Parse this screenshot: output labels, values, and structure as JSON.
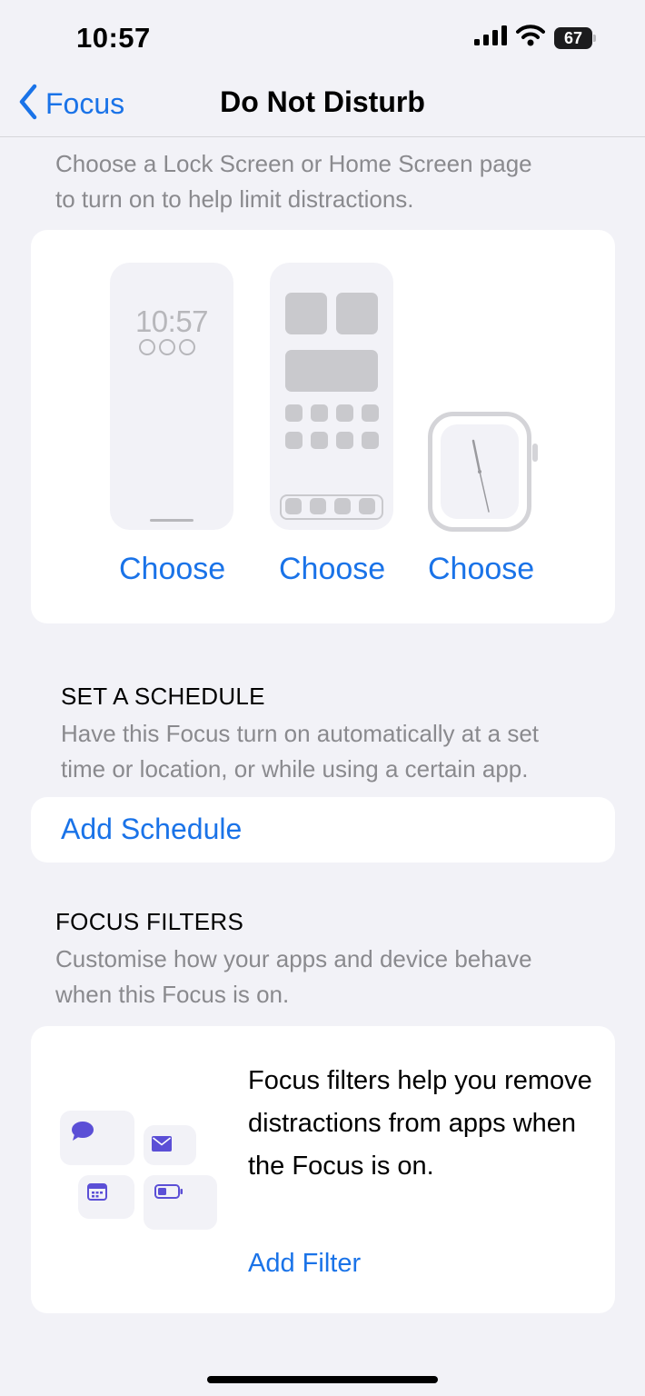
{
  "status_bar": {
    "time": "10:57",
    "battery_percent": "67"
  },
  "nav": {
    "back_label": "Focus",
    "title": "Do Not Disturb"
  },
  "customize_screens": {
    "description": "Choose a Lock Screen or Home Screen page\nto turn on to help limit distractions.",
    "lock_screen_preview_time": "10:57",
    "choose_lock_screen": "Choose",
    "choose_home_screen": "Choose",
    "choose_watch_face": "Choose"
  },
  "schedule": {
    "heading": "SET A SCHEDULE",
    "description": "Have this Focus turn on automatically at a set\ntime or location, or while using a certain app.",
    "add_label": "Add Schedule"
  },
  "filters": {
    "heading": "FOCUS FILTERS",
    "description": "Customise how your apps and device behave\nwhen this Focus is on.",
    "body": "Focus filters help you remove distractions from apps when the Focus is on.",
    "add_label": "Add Filter"
  },
  "colors": {
    "accent": "#1A73E8",
    "background": "#F2F2F7",
    "secondary_text": "#8A8A8E",
    "illustration_purple": "#5B4FD6"
  }
}
